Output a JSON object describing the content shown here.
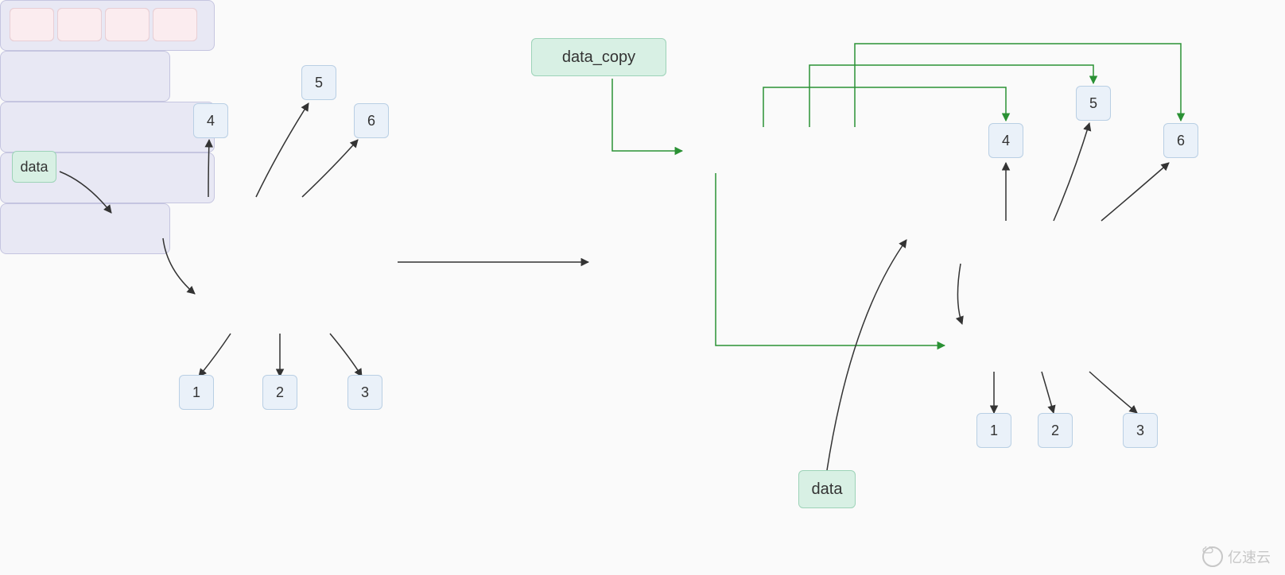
{
  "left": {
    "data_label": "data",
    "numbers": {
      "n4": "4",
      "n5": "5",
      "n6": "6",
      "n1": "1",
      "n2": "2",
      "n3": "3"
    }
  },
  "right": {
    "data_copy_label": "data_copy",
    "data_label": "data",
    "numbers": {
      "n4": "4",
      "n5": "5",
      "n6": "6",
      "n1": "1",
      "n2": "2",
      "n3": "3"
    }
  },
  "watermark": "亿速云",
  "colors": {
    "data_box_bg": "#d8f0e4",
    "num_box_bg": "#eaf1f9",
    "container_bg": "#e8e8f4",
    "slot_bg": "#fbecef",
    "arrow_black": "#333333",
    "arrow_green": "#2a9134"
  }
}
